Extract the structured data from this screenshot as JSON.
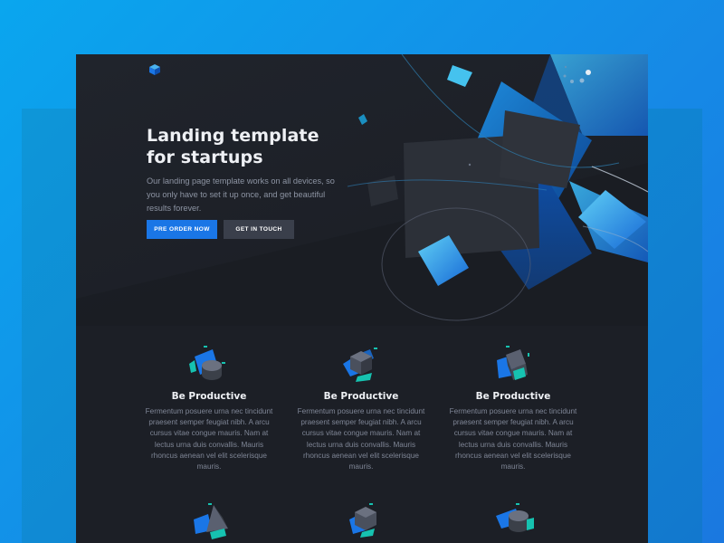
{
  "hero": {
    "title": "Landing template for startups",
    "subtitle": "Our landing page template works on all devices, so you only have to set it up once, and get beautiful results forever.",
    "primary_button": "PRE ORDER NOW",
    "secondary_button": "GET IN TOUCH"
  },
  "features": [
    {
      "icon": "cylinder-cube-icon",
      "title": "Be Productive",
      "text": "Fermentum posuere urna nec tincidunt praesent semper feugiat nibh. A arcu cursus vitae congue mauris. Nam at lectus urna duis convallis. Mauris rhoncus aenean vel elit scelerisque mauris."
    },
    {
      "icon": "hexagon-cube-icon",
      "title": "Be Productive",
      "text": "Fermentum posuere urna nec tincidunt praesent semper feugiat nibh. A arcu cursus vitae congue mauris. Nam at lectus urna duis convallis. Mauris rhoncus aenean vel elit scelerisque mauris."
    },
    {
      "icon": "tilted-cube-icon",
      "title": "Be Productive",
      "text": "Fermentum posuere urna nec tincidunt praesent semper feugiat nibh. A arcu cursus vitae congue mauris. Nam at lectus urna duis convallis. Mauris rhoncus aenean vel elit scelerisque mauris."
    }
  ],
  "colors": {
    "page_background": "#1c1f26",
    "accent_blue": "#1a76e6",
    "accent_teal": "#16c2b0",
    "outer_background": "#0aa6ee"
  }
}
